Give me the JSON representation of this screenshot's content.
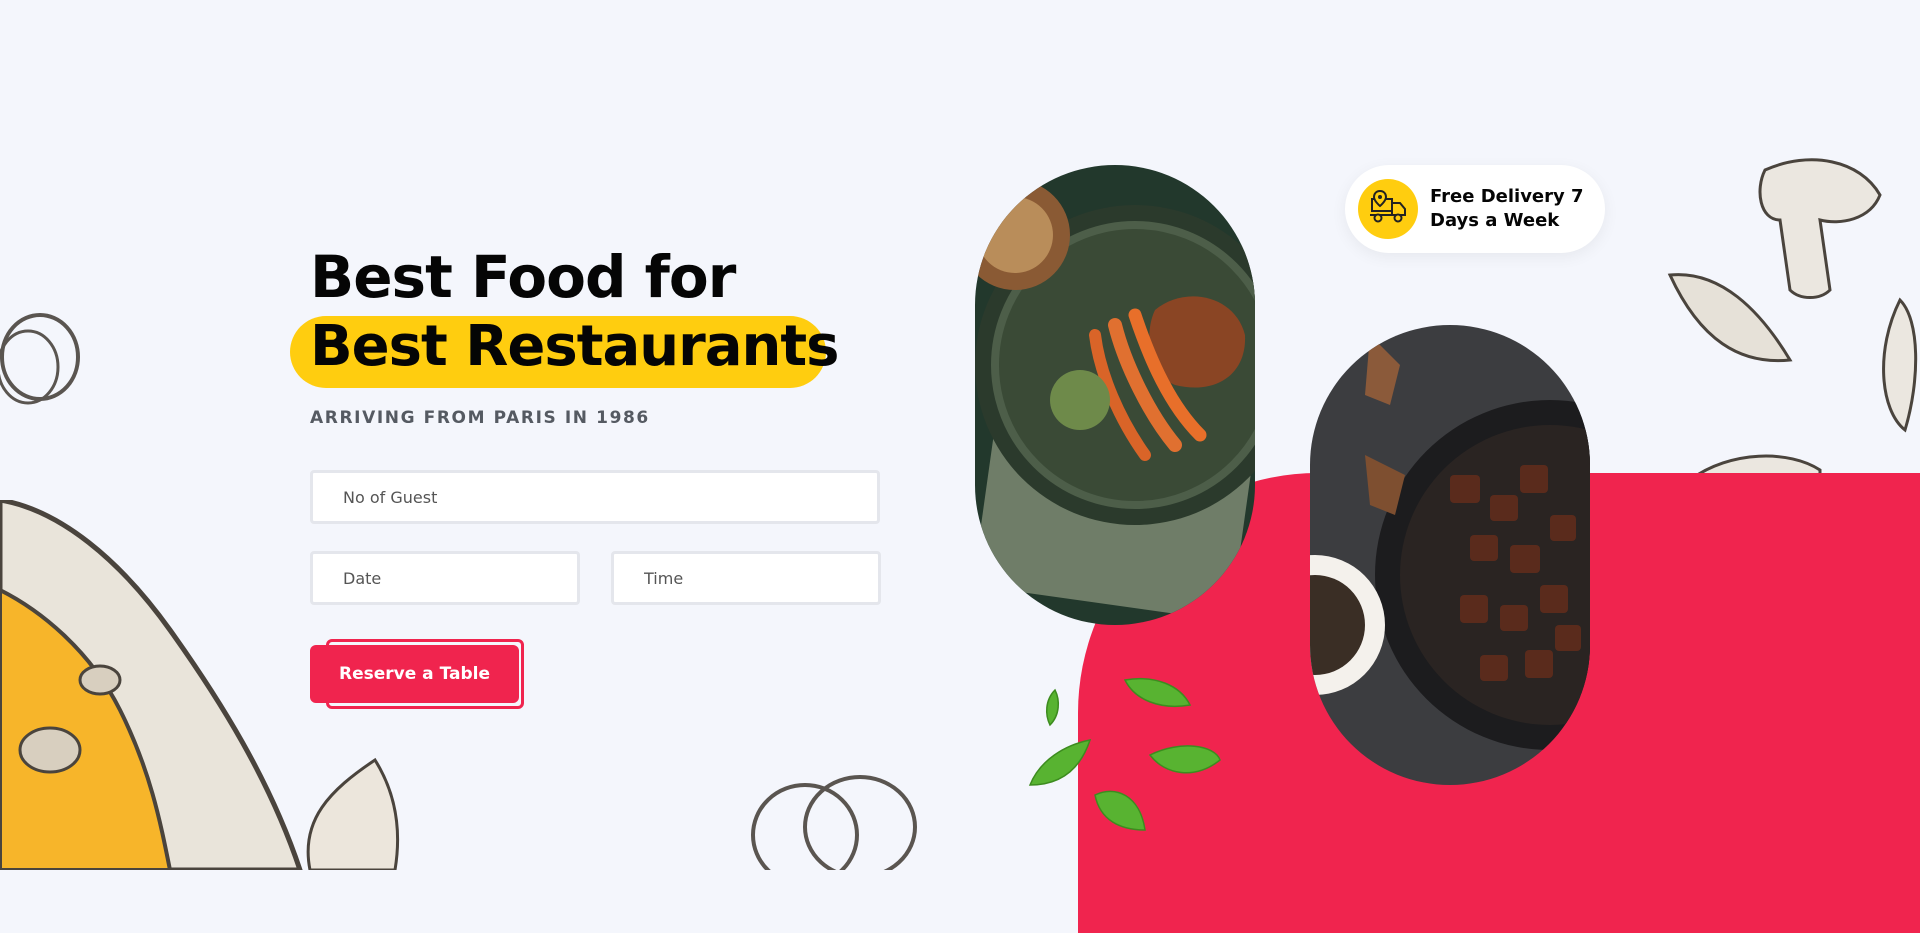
{
  "hero": {
    "title_line1": "Best Food for",
    "title_line2": "Best Restaurants",
    "subtitle": "ARRIVING FROM PARIS IN 1986"
  },
  "form": {
    "guest_placeholder": "No of Guest",
    "date_placeholder": "Date",
    "time_placeholder": "Time",
    "reserve_label": "Reserve a Table"
  },
  "badge": {
    "text": "Free Delivery 7 Days a Week",
    "icon": "delivery-truck-icon"
  },
  "images": [
    "steak-carrots-plate",
    "beef-skillet"
  ],
  "colors": {
    "accent_red": "#f0244e",
    "accent_yellow": "#ffcd0f",
    "background": "#f4f6fc",
    "text_dark": "#050505"
  }
}
